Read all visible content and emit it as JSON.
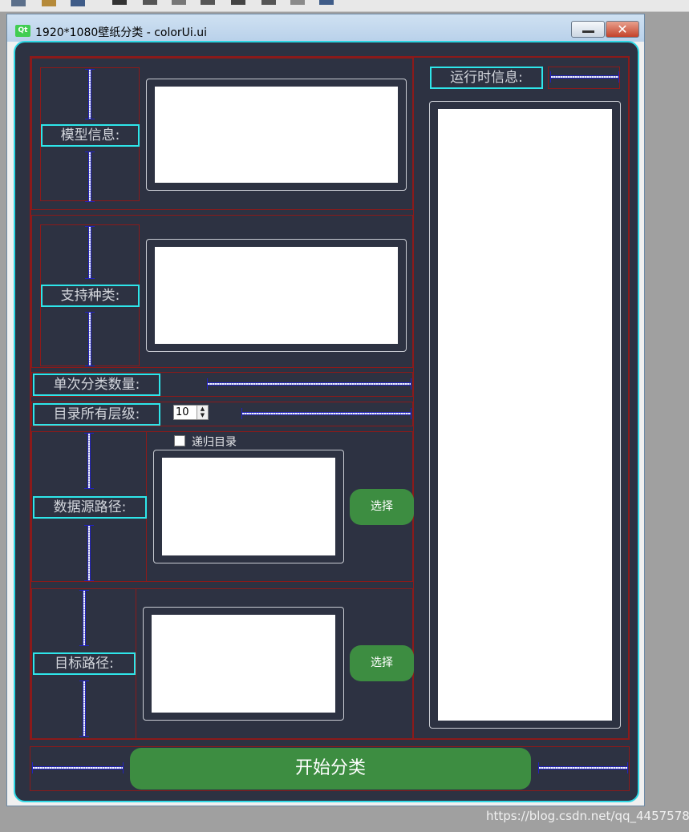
{
  "window": {
    "title": "1920*1080壁纸分类 - colorUi.ui",
    "logo_text": "Qt",
    "close_glyph": "✕"
  },
  "toolbar": {
    "icons": [
      "new-form-icon",
      "edit-icon",
      "save-icon",
      "layout-h-icon",
      "layout-v-icon",
      "layout-split-icon",
      "layout-grid-icon",
      "break-layout-icon",
      "adjust-size-icon",
      "help-icon",
      "preview-icon"
    ]
  },
  "labels": {
    "model_info": "模型信息:",
    "supported_classes": "支持种类:",
    "batch_count": "单次分类数量:",
    "dir_depth": "目录所有层级:",
    "data_source_path": "数据源路径:",
    "target_path": "目标路径:",
    "runtime_info": "运行时信息:"
  },
  "controls": {
    "batch_count_value": "10",
    "recursive_checkbox_label": "递归目录",
    "recursive_checked": false,
    "select_source_button": "选择",
    "select_target_button": "选择",
    "start_button": "开始分类"
  },
  "colors": {
    "background": "#2d3242",
    "label_border": "#2ee6ea",
    "layout_border": "#8b1a1a",
    "button_green": "#3d8d41",
    "textbox_fill": "#ffffff"
  },
  "watermark": "https://blog.csdn.net/qq_44575789"
}
